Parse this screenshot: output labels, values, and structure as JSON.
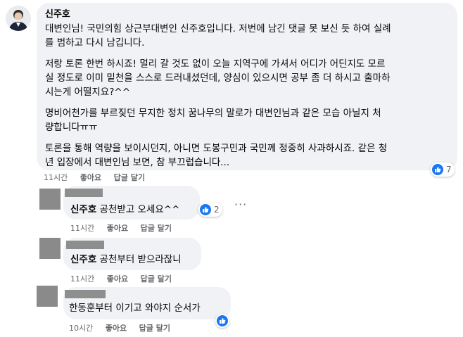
{
  "comment": {
    "author": "신주호",
    "paragraphs": [
      "대변인님! 국민의힘 상근부대변인 신주호입니다. 저번에 남긴 댓글 못 보신 듯 하여 실례\n를 범하고 다시 남깁니다.",
      "저랑 토론 한번 하시죠! 멀리 갈 것도 없이 오늘 지역구에 가셔서 어디가 어딘지도 모르\n실 정도로 이미 밑천을 스스로 드러내셨던데, 양심이 있으시면 공부 좀 더 하시고 출마하\n시는게 어떨지요?^^",
      "명비어천가를 부르짖던 무지한 정치 꿈나무의 말로가 대변인님과 같은 모습 아닐지 처\n량합니다ㅠㅠ",
      "토론을 통해 역량을 보이시던지, 아니면 도봉구민과 국민께 정중히 사과하시죠. 같은 청\n년 입장에서 대변인님 보면, 참 부끄럽습니다..."
    ],
    "time": "11시간",
    "like_label": "좋아요",
    "reply_label": "답글 달기",
    "like_count": "7"
  },
  "replies": [
    {
      "mention": "신주호",
      "text": " 공천받고 오세요^^",
      "time": "11시간",
      "like_label": "좋아요",
      "reply_label": "답글 달기",
      "like_count": "2",
      "more": "···"
    },
    {
      "mention": "신주호",
      "text": " 공천부터 받으라잖니",
      "time": "11시간",
      "like_label": "좋아요",
      "reply_label": "답글 달기"
    },
    {
      "mention": "",
      "text": "한동훈부터 이기고 와야지 순서가",
      "time": "10시간",
      "like_label": "좋아요",
      "reply_label": "답글 달기"
    }
  ],
  "icons": {
    "avatar": "profile-avatar",
    "like": "thumbs-up-icon",
    "more": "more-options-icon"
  },
  "colors": {
    "bubble": "#f0f2f5",
    "like_blue": "#1877f2",
    "meta_text": "#65676b",
    "redacted": "#8a8a8a"
  }
}
